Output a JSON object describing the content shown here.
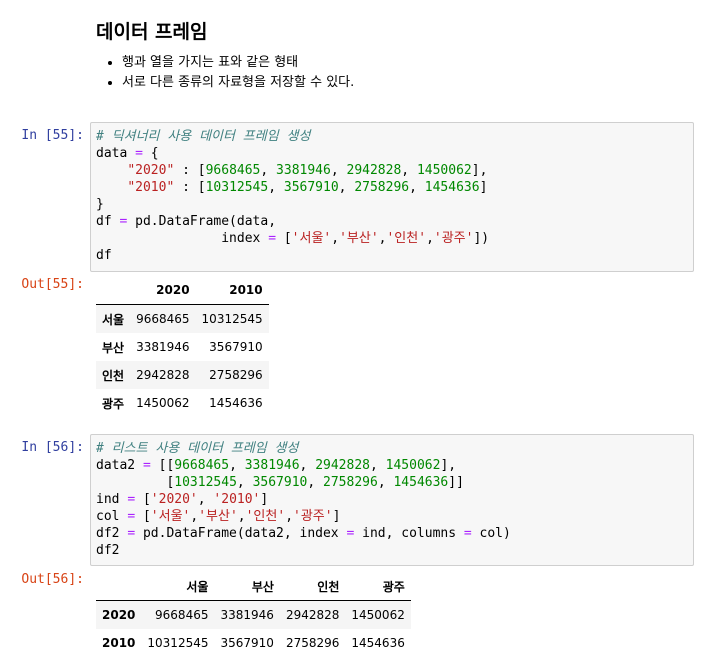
{
  "markdown": {
    "title": "데이터 프레임",
    "bullets": [
      "행과 열을 가지는 표와 같은 형태",
      "서로 다른 종류의 자료형을 저장할 수 있다."
    ]
  },
  "cells": [
    {
      "in_prompt": "In [55]:",
      "out_prompt": "Out[55]:",
      "code_lines": [
        "# 딕셔너리 사용 데이터 프레임 생성",
        "data = {",
        "    \"2020\" : [9668465, 3381946, 2942828, 1450062],",
        "    \"2010\" : [10312545, 3567910, 2758296, 1454636]",
        "}",
        "df = pd.DataFrame(data,",
        "                index = ['서울','부산','인천','광주'])",
        "df"
      ],
      "output_table": {
        "columns": [
          "2020",
          "2010"
        ],
        "rows": [
          {
            "index": "서울",
            "values": [
              "9668465",
              "10312545"
            ]
          },
          {
            "index": "부산",
            "values": [
              "3381946",
              "3567910"
            ]
          },
          {
            "index": "인천",
            "values": [
              "2942828",
              "2758296"
            ]
          },
          {
            "index": "광주",
            "values": [
              "1450062",
              "1454636"
            ]
          }
        ]
      }
    },
    {
      "in_prompt": "In [56]:",
      "out_prompt": "Out[56]:",
      "code_lines": [
        "# 리스트 사용 데이터 프레임 생성",
        "data2 = [[9668465, 3381946, 2942828, 1450062],",
        "         [10312545, 3567910, 2758296, 1454636]]",
        "ind = ['2020', '2010']",
        "col = ['서울','부산','인천','광주']",
        "df2 = pd.DataFrame(data2, index = ind, columns = col)",
        "df2"
      ],
      "output_table": {
        "columns": [
          "서울",
          "부산",
          "인천",
          "광주"
        ],
        "rows": [
          {
            "index": "2020",
            "values": [
              "9668465",
              "3381946",
              "2942828",
              "1450062"
            ]
          },
          {
            "index": "2010",
            "values": [
              "10312545",
              "3567910",
              "2758296",
              "1454636"
            ]
          }
        ]
      }
    }
  ]
}
